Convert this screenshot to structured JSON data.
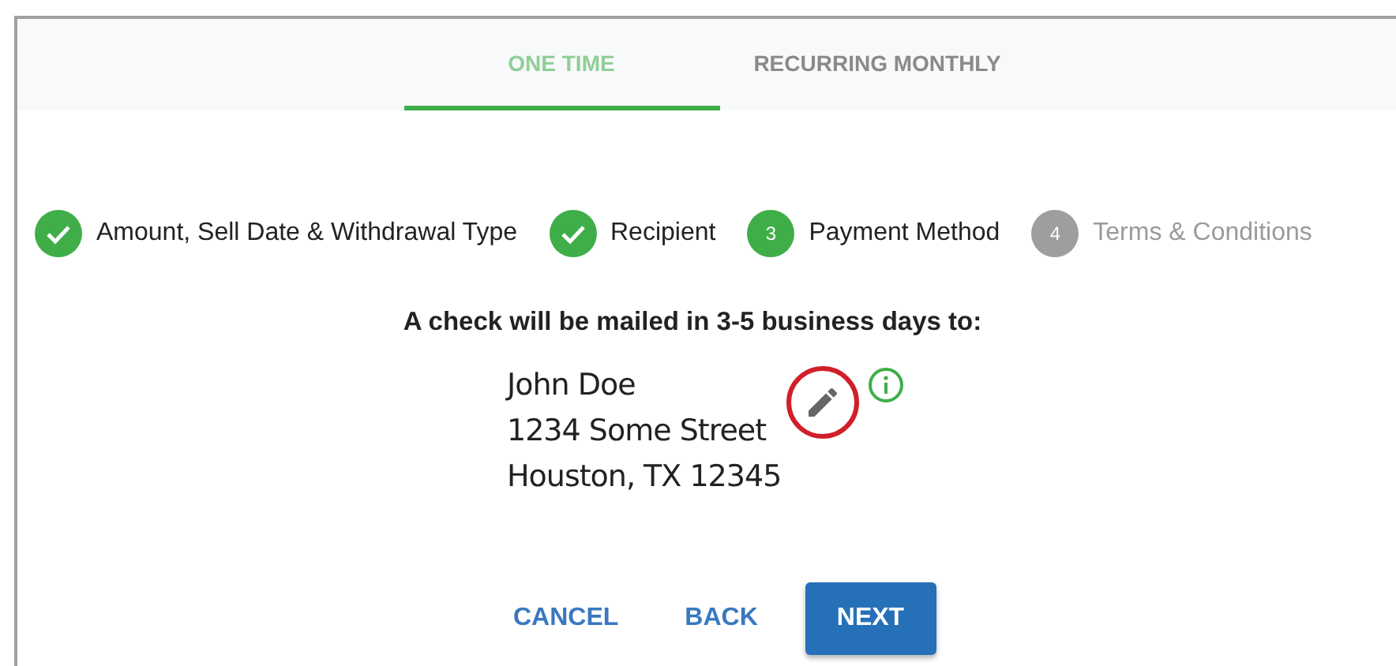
{
  "tabs": [
    {
      "label": "ONE TIME",
      "selected": true
    },
    {
      "label": "RECURRING MONTHLY",
      "selected": false
    }
  ],
  "steps": [
    {
      "label": "Amount, Sell Date & Withdrawal Type",
      "completed": true,
      "disabled": false
    },
    {
      "label": "Recipient",
      "completed": true,
      "disabled": false
    },
    {
      "label": "Payment Method",
      "completed": false,
      "disabled": false,
      "number": "3"
    },
    {
      "label": "Terms & Conditions",
      "completed": false,
      "disabled": true,
      "number": "4"
    }
  ],
  "heading": "A check will be mailed in 3-5 business days to:",
  "address": [
    "John Doe",
    "1234 Some Street",
    "Houston, TX 12345"
  ],
  "edit_highlighted": true,
  "buttons": [
    {
      "label": "CANCEL",
      "kind": "text"
    },
    {
      "label": "BACK",
      "kind": "text"
    },
    {
      "label": "NEXT",
      "kind": "primary"
    }
  ]
}
